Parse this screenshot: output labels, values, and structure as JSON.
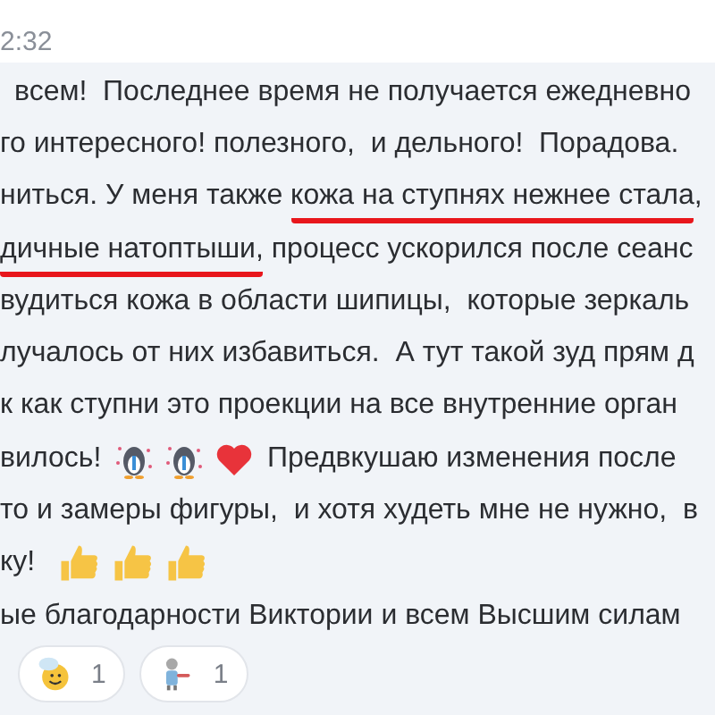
{
  "timestamp": "2:32",
  "message": {
    "lines": [
      {
        "segments": [
          {
            "kind": "text",
            "text": "всем!  Последнее время не получается ежедневно",
            "underlined": false
          }
        ]
      },
      {
        "segments": [
          {
            "kind": "text",
            "text": "го интересного! полезного,  и дельного!  Порадова.",
            "underlined": false
          }
        ]
      },
      {
        "segments": [
          {
            "kind": "text",
            "text": "ниться. У меня также ",
            "underlined": false
          },
          {
            "kind": "text",
            "text": "кожа на ступнях нежнее стала",
            "underlined": true
          },
          {
            "kind": "text",
            "text": ",",
            "underlined": false
          }
        ]
      },
      {
        "segments": [
          {
            "kind": "text",
            "text": "дичные натоптыши,",
            "underlined": true
          },
          {
            "kind": "text",
            "text": " процесс ускорился после сеанс",
            "underlined": false
          }
        ]
      },
      {
        "segments": [
          {
            "kind": "text",
            "text": "вудиться кожа в области шипицы,  которые зеркаль",
            "underlined": false
          }
        ]
      },
      {
        "segments": [
          {
            "kind": "text",
            "text": "лучалось от них избавиться.  А тут такой зуд прям д",
            "underlined": false
          }
        ]
      },
      {
        "segments": [
          {
            "kind": "text",
            "text": "к как ступни это проекции на все внутренние орган",
            "underlined": false
          }
        ]
      },
      {
        "segments": [
          {
            "kind": "text",
            "text": "вилось! ",
            "underlined": false
          },
          {
            "kind": "penguin"
          },
          {
            "kind": "penguin"
          },
          {
            "kind": "heart"
          },
          {
            "kind": "text",
            "text": " Предвкушаю изменения после",
            "underlined": false
          }
        ]
      },
      {
        "segments": [
          {
            "kind": "text",
            "text": "то и замеры фигуры,  и хотя худеть мне не нужно,  в",
            "underlined": false
          }
        ]
      },
      {
        "segments": [
          {
            "kind": "text",
            "text": "ку!  ",
            "underlined": false
          },
          {
            "kind": "thumbs-up"
          },
          {
            "kind": "thumbs-up"
          },
          {
            "kind": "thumbs-up"
          }
        ]
      },
      {
        "segments": [
          {
            "kind": "text",
            "text": "ые благодарности Виктории и всем Высшим силам",
            "underlined": false
          }
        ]
      }
    ]
  },
  "reactions": [
    {
      "kind": "smiley",
      "count": "1"
    },
    {
      "kind": "figure",
      "count": "1"
    }
  ]
}
